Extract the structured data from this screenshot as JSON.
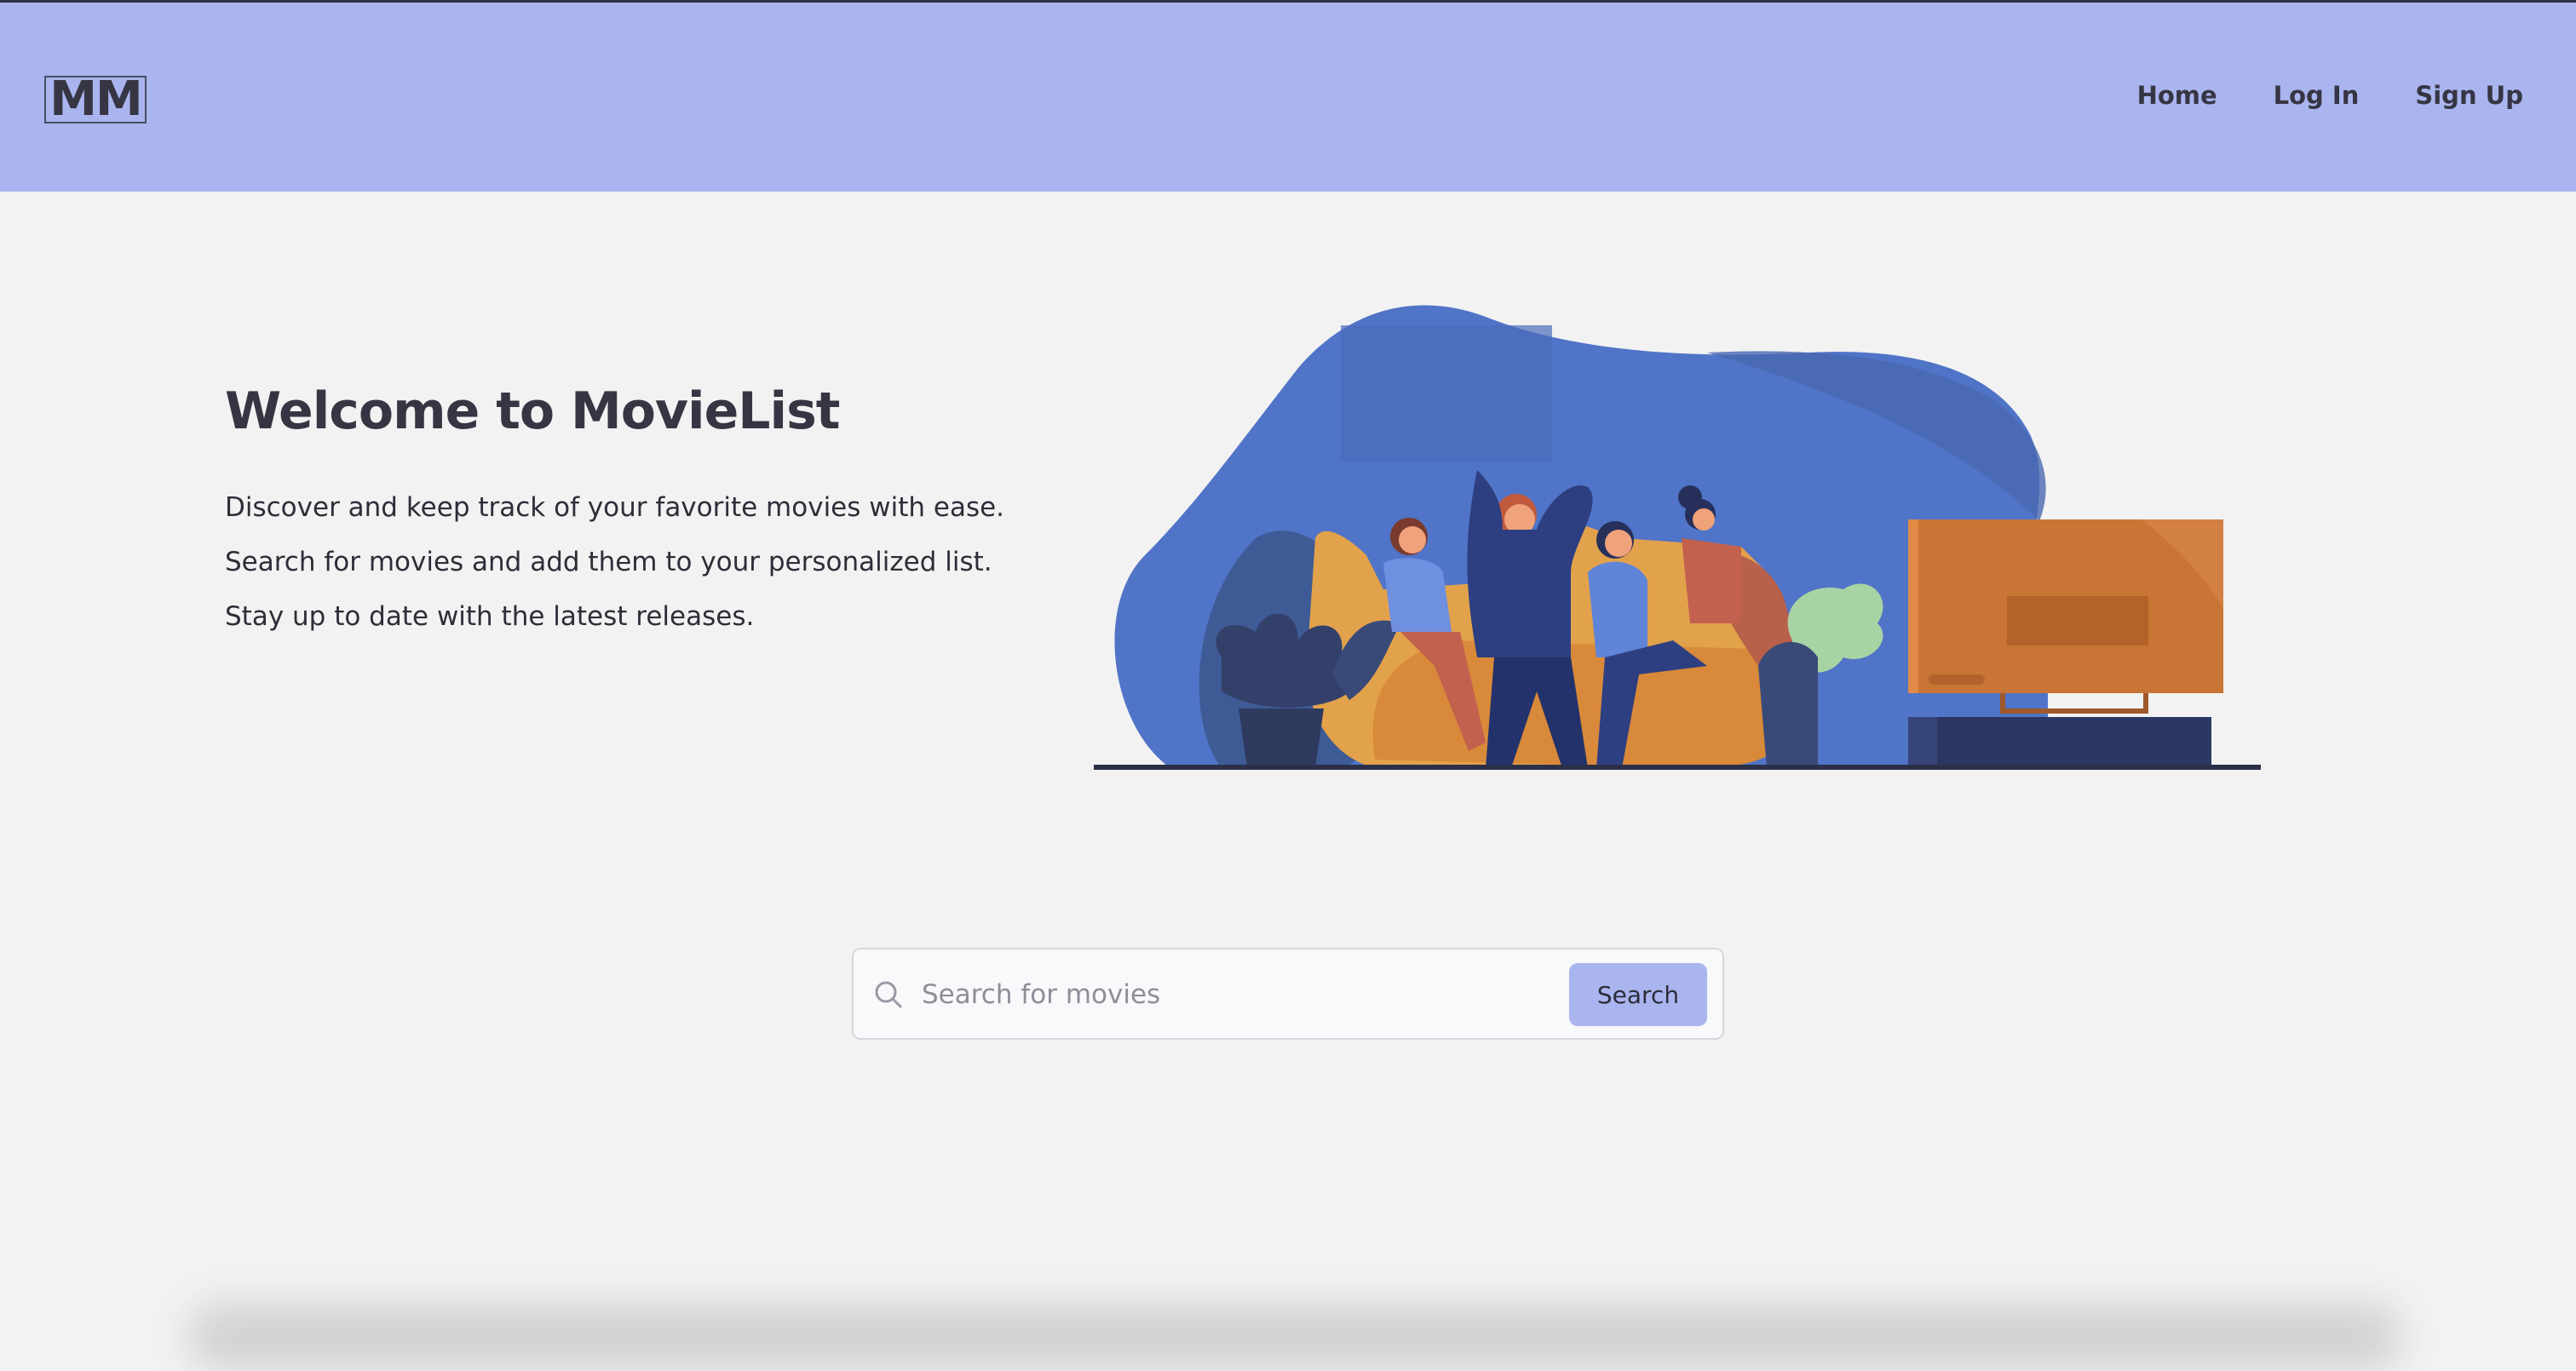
{
  "navbar": {
    "logo_text": "MM",
    "links": [
      {
        "label": "Home"
      },
      {
        "label": "Log In"
      },
      {
        "label": "Sign Up"
      }
    ]
  },
  "hero": {
    "title": "Welcome to MovieList",
    "lines": [
      "Discover and keep track of your favorite movies with ease.",
      "Search for movies and add them to your personalized list.",
      "Stay up to date with the latest releases."
    ],
    "illustration_icon": "people-watching-tv-illustration"
  },
  "search": {
    "placeholder": "Search for movies",
    "value": "",
    "button_label": "Search",
    "icon": "search-icon"
  },
  "colors": {
    "navbar_bg": "#aab5ef",
    "page_bg": "#f2f2f2",
    "text": "#363543",
    "accent_blue": "#5074c7",
    "accent_orange": "#c97535"
  }
}
